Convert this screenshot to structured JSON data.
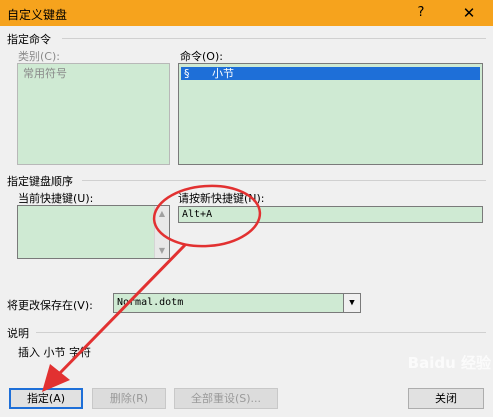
{
  "window": {
    "title": "自定义键盘",
    "help": "?",
    "close": "✕"
  },
  "commands_group": {
    "title": "指定命令",
    "categories_label": "类别(C):",
    "categories": [
      "常用符号"
    ],
    "commands_label": "命令(O):",
    "commands": [
      {
        "symbol": "§",
        "label": "小节"
      }
    ]
  },
  "keys_group": {
    "title": "指定键盘顺序",
    "current_label": "当前快捷键(U):",
    "new_label": "请按新快捷键(N):",
    "new_value": "Alt+A"
  },
  "save_in": {
    "label": "将更改保存在(V):",
    "value": "Normal.dotm"
  },
  "description": {
    "title": "说明",
    "text": "插入 小节 字符"
  },
  "buttons": {
    "assign": "指定(A)",
    "remove": "删除(R)",
    "reset_all": "全部重设(S)...",
    "close": "关闭"
  },
  "colors": {
    "title_bar": "#f6a31d",
    "list_bg": "#cfead3",
    "selection": "#1e6fd8",
    "annotation": "#e23131"
  },
  "watermark": {
    "text": "Baidu 经验"
  }
}
